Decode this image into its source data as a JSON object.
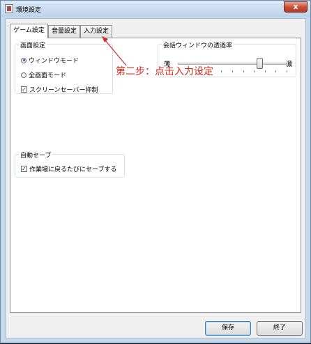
{
  "window": {
    "title": "環境設定",
    "close_label": "x"
  },
  "tabs": [
    {
      "label": "ゲーム設定",
      "active": true
    },
    {
      "label": "音量設定",
      "active": false
    },
    {
      "label": "入力設定",
      "active": false
    }
  ],
  "screen_group": {
    "legend": "画面設定",
    "options": [
      {
        "label": "ウィンドウモード",
        "type": "radio",
        "checked": true
      },
      {
        "label": "全画面モード",
        "type": "radio",
        "checked": false
      },
      {
        "label": "スクリーンセーバー抑制",
        "type": "checkbox",
        "checked": true
      }
    ]
  },
  "transparency_group": {
    "legend": "会話ウィンドウの透過率",
    "min_label": "薄",
    "max_label": "濃",
    "value_fraction": 0.75
  },
  "autosave_group": {
    "legend": "自動セーブ",
    "option": {
      "label": "作業場に戻るたびにセーブする",
      "checked": true
    }
  },
  "buttons": {
    "save": "保存",
    "exit": "終了"
  },
  "annotation": {
    "text": "第二步：点击入力设定",
    "color": "#d42a1f"
  }
}
